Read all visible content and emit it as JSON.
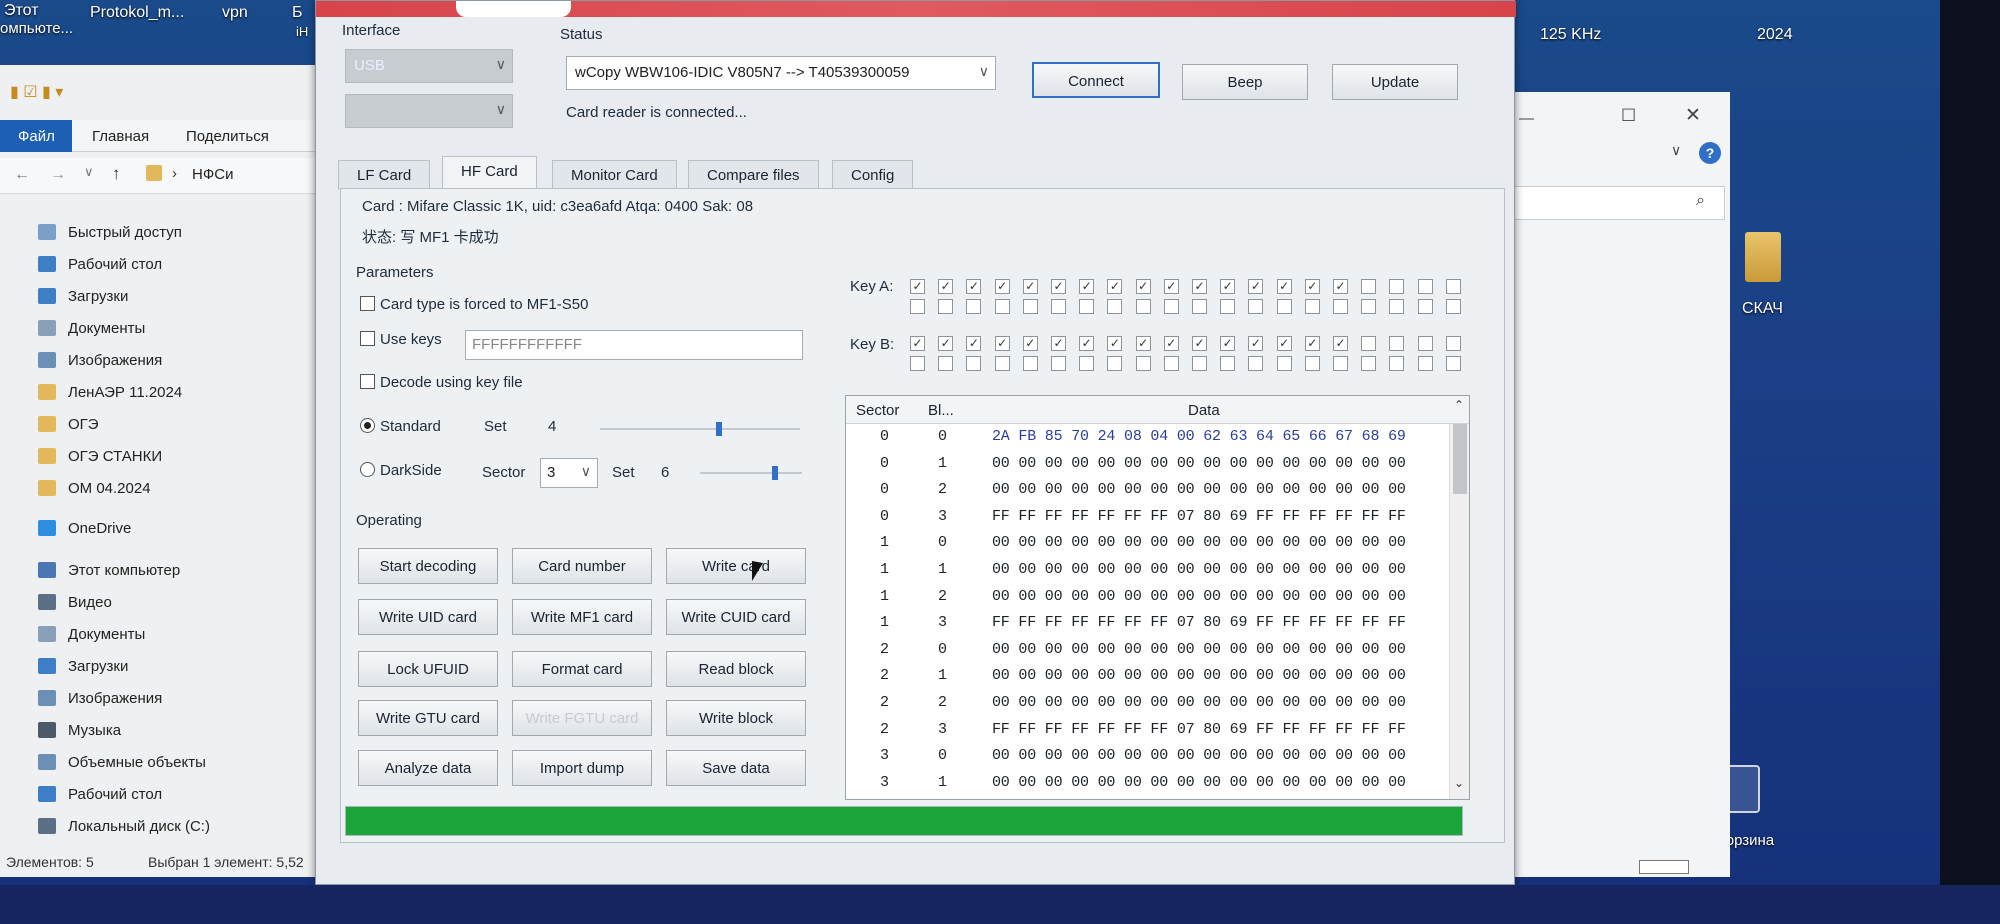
{
  "desktop": {
    "top_left": [
      "Этот",
      "омпьюте...",
      "Protokol_m...",
      "vpn",
      "Б",
      "iH"
    ],
    "top_right": [
      "125 KHz",
      "2024"
    ],
    "folder_label": "СКАЧ",
    "recycle_label": "Корзина"
  },
  "explorer": {
    "ribbon_tabs": [
      "Файл",
      "Главная",
      "Поделиться"
    ],
    "path_crumb": "НФСи",
    "nav_items": [
      "Быстрый доступ",
      "Рабочий стол",
      "Загрузки",
      "Документы",
      "Изображения",
      "ЛенАЭР 11.2024",
      "ОГЭ",
      "ОГЭ СТАНКИ",
      "ОМ 04.2024",
      "OneDrive",
      "Этот компьютер",
      "Видео",
      "Документы",
      "Загрузки",
      "Изображения",
      "Музыка",
      "Объемные объекты",
      "Рабочий стол",
      "Локальный диск (C:)"
    ],
    "status_items": "Элементов: 5",
    "status_selected": "Выбран 1 элемент: 5,52"
  },
  "app": {
    "interface_title": "Interface",
    "interface_value": "USB",
    "status_title": "Status",
    "device_value": "wCopy WBW106-IDIC V805N7 --> T40539300059",
    "status_text": "Card reader is connected...",
    "btn_connect": "Connect",
    "btn_beep": "Beep",
    "btn_update": "Update",
    "tabs": [
      "LF Card",
      "HF Card",
      "Monitor Card",
      "Compare files",
      "Config"
    ],
    "active_tab": "HF Card",
    "card_info": "Card : Mifare Classic 1K, uid: c3ea6afd   Atqa: 0400   Sak: 08",
    "card_state": "状态: 写 MF1 卡成功",
    "parameters_title": "Parameters",
    "chk_forced": "Card type is forced to MF1-S50",
    "chk_usekeys": "Use keys",
    "keys_value": "FFFFFFFFFFFF",
    "chk_decode": "Decode using key file",
    "radio_standard": "Standard",
    "set_label_1": "Set",
    "set_value_1": "4",
    "slider1_fraction": 0.6,
    "radio_darkside": "DarkSide",
    "sector_label": "Sector",
    "sector_value": "3",
    "set_label_2": "Set",
    "set_value_2": "6",
    "slider2_fraction": 0.75,
    "operating_title": "Operating",
    "buttons": [
      [
        "Start decoding",
        "Card number",
        "Write card"
      ],
      [
        "Write UID card",
        "Write MF1 card",
        "Write CUID card"
      ],
      [
        "Lock UFUID",
        "Format card",
        "Read block"
      ],
      [
        "Write GTU card",
        "Write FGTU card",
        "Write block"
      ],
      [
        "Analyze data",
        "Import dump",
        "Save data"
      ]
    ],
    "key_a_label": "Key A:",
    "key_b_label": "Key B:",
    "key_a_checked": [
      1,
      1,
      1,
      1,
      1,
      1,
      1,
      1,
      1,
      1,
      1,
      1,
      1,
      1,
      1,
      1,
      0,
      0,
      0,
      0
    ],
    "key_b_checked": [
      1,
      1,
      1,
      1,
      1,
      1,
      1,
      1,
      1,
      1,
      1,
      1,
      1,
      1,
      1,
      1,
      0,
      0,
      0,
      0
    ],
    "grid_headers": [
      "Sector",
      "Bl...",
      "Data"
    ],
    "grid_rows": [
      [
        "0",
        "0",
        "2A FB 85 70 24 08 04 00 62 63 64 65 66 67 68 69"
      ],
      [
        "0",
        "1",
        "00 00 00 00 00 00 00 00 00 00 00 00 00 00 00 00"
      ],
      [
        "0",
        "2",
        "00 00 00 00 00 00 00 00 00 00 00 00 00 00 00 00"
      ],
      [
        "0",
        "3",
        "FF FF FF FF FF FF FF 07 80 69 FF FF FF FF FF FF"
      ],
      [
        "1",
        "0",
        "00 00 00 00 00 00 00 00 00 00 00 00 00 00 00 00"
      ],
      [
        "1",
        "1",
        "00 00 00 00 00 00 00 00 00 00 00 00 00 00 00 00"
      ],
      [
        "1",
        "2",
        "00 00 00 00 00 00 00 00 00 00 00 00 00 00 00 00"
      ],
      [
        "1",
        "3",
        "FF FF FF FF FF FF FF 07 80 69 FF FF FF FF FF FF"
      ],
      [
        "2",
        "0",
        "00 00 00 00 00 00 00 00 00 00 00 00 00 00 00 00"
      ],
      [
        "2",
        "1",
        "00 00 00 00 00 00 00 00 00 00 00 00 00 00 00 00"
      ],
      [
        "2",
        "2",
        "00 00 00 00 00 00 00 00 00 00 00 00 00 00 00 00"
      ],
      [
        "2",
        "3",
        "FF FF FF FF FF FF FF 07 80 69 FF FF FF FF FF FF"
      ],
      [
        "3",
        "0",
        "00 00 00 00 00 00 00 00 00 00 00 00 00 00 00 00"
      ],
      [
        "3",
        "1",
        "00 00 00 00 00 00 00 00 00 00 00 00 00 00 00 00"
      ]
    ],
    "progress_fraction": 1.0,
    "colors": {
      "accent": "#2f6fc7",
      "progress": "#1aa63a",
      "band": "#d7444a"
    }
  }
}
